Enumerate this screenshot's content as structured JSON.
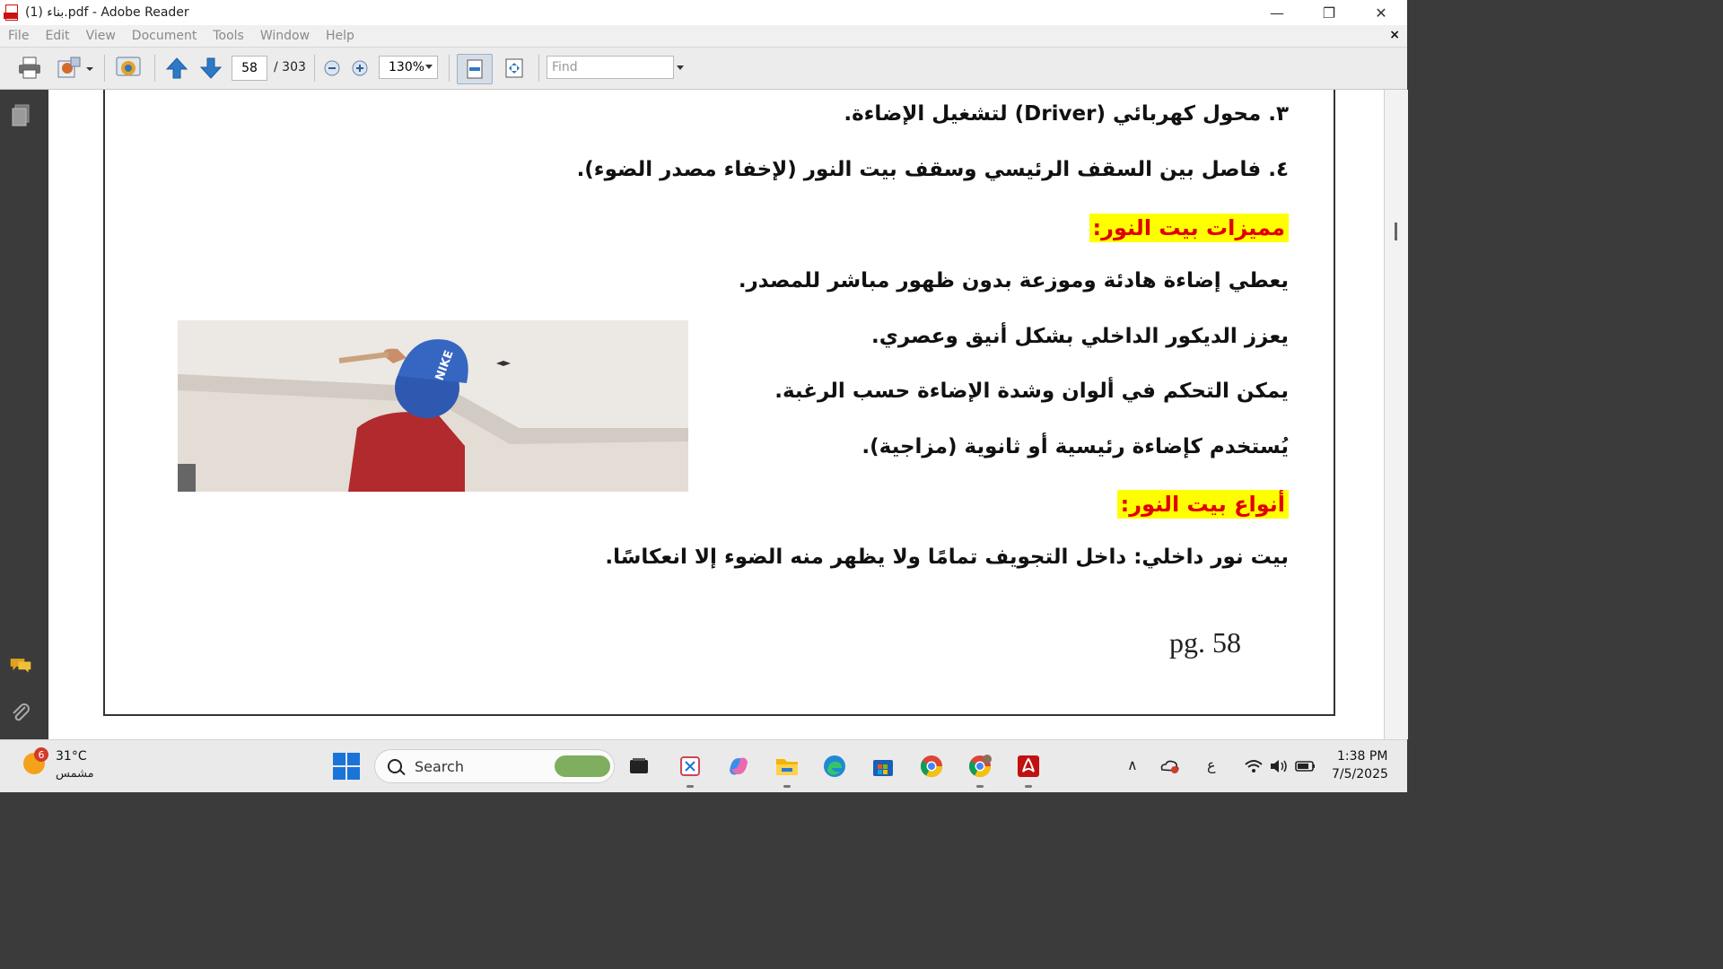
{
  "window": {
    "title": "بناء (1).pdf - Adobe Reader",
    "minimize": "—",
    "restore": "❐",
    "close": "✕"
  },
  "menu": {
    "items": [
      "File",
      "Edit",
      "View",
      "Document",
      "Tools",
      "Window",
      "Help"
    ],
    "close_doc": "×"
  },
  "toolbar": {
    "page_current": "58",
    "page_total": "/ 303",
    "zoom": "130%",
    "find_placeholder": "Find"
  },
  "document": {
    "lines": [
      "٣. محول كهربائي (Driver) لتشغيل الإضاءة.",
      "٤. فاصل بين السقف الرئيسي وسقف بيت النور (لإخفاء مصدر الضوء).",
      "يعطي إضاءة هادئة وموزعة بدون ظهور مباشر للمصدر.",
      "يعزز الديكور الداخلي بشكل أنيق وعصري.",
      "يمكن التحكم في ألوان وشدة الإضاءة حسب الرغبة.",
      "يُستخدم كإضاءة رئيسية أو ثانوية (مزاجية).",
      "بيت نور داخلي: داخل التجويف تمامًا ولا يظهر منه الضوء إلا انعكاسًا."
    ],
    "headings": [
      "مميزات بيت النور:",
      "أنواع بيت النور:"
    ],
    "page_label": "pg. 58",
    "photo_text": "NIKE"
  },
  "taskbar": {
    "weather_badge": "6",
    "temperature": "31°C",
    "condition": "مشمس",
    "search_label": "Search",
    "language": "ع",
    "time": "1:38 PM",
    "date": "7/5/2025"
  },
  "colors": {
    "heading_text": "#e00000",
    "heading_bg": "#ffff00",
    "accent_blue": "#1a73d9",
    "acrobat_red": "#c11111"
  }
}
